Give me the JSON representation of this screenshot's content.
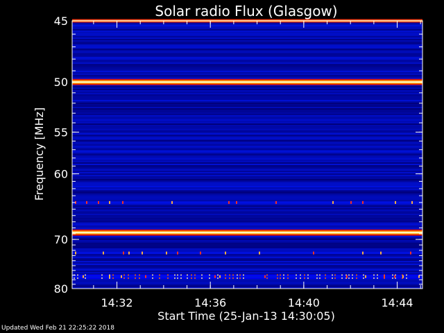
{
  "chart_data": {
    "type": "heatmap",
    "title": "Solar radio Flux (Glasgow)",
    "xlabel": "Start Time (25-Jan-13 14:30:05)",
    "ylabel": "Frequency [MHz]",
    "x_start": "14:30:05",
    "x_end": "14:45:05",
    "x_ticks": [
      "14:32",
      "14:36",
      "14:40",
      "14:44"
    ],
    "y_ticks": [
      45,
      50,
      55,
      60,
      70,
      80
    ],
    "y_range": [
      45,
      80
    ],
    "y_scale": "reciprocal",
    "colormap": [
      "#000080",
      "#0000d0",
      "#c01010",
      "#ff6000",
      "#ffd040",
      "#ffffe0"
    ],
    "background_level": "dark-blue",
    "bright_lines_mhz": [
      {
        "freq": 45,
        "level": "high"
      },
      {
        "freq": 50,
        "level": "very-high"
      },
      {
        "freq": 68.8,
        "level": "very-high"
      },
      {
        "freq": 77.3,
        "level": "intermittent-high"
      }
    ],
    "speckle_lines_mhz": [
      64,
      72.5,
      77.3
    ]
  },
  "footer": {
    "updated": "Updated Wed Feb 21 22:25:22 2018"
  }
}
